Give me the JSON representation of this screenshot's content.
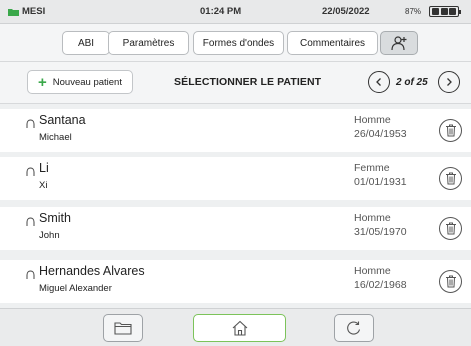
{
  "status_bar": {
    "app_name": "MESI",
    "time": "01:24 PM",
    "date": "22/05/2022",
    "battery_percent": "87%"
  },
  "tabs": [
    {
      "label": "ABI"
    },
    {
      "label": "Paramètres"
    },
    {
      "label": "Formes d'ondes"
    },
    {
      "label": "Commentaires"
    },
    {
      "label": "",
      "icon": "patient-icon",
      "active": true
    }
  ],
  "header": {
    "new_patient_label": "Nouveau patient",
    "title": "SÉLECTIONNER LE PATIENT",
    "pager": "2 of 25"
  },
  "patients": [
    {
      "last_name": "Santana",
      "first_name": "Michael",
      "gender": "Homme",
      "dob": "26/04/1953"
    },
    {
      "last_name": "Li",
      "first_name": "Xi",
      "gender": "Femme",
      "dob": "01/01/1931"
    },
    {
      "last_name": "Smith",
      "first_name": "John",
      "gender": "Homme",
      "dob": "31/05/1970"
    },
    {
      "last_name": "Hernandes Alvares",
      "first_name": "Miguel Alexander",
      "gender": "Homme",
      "dob": "16/02/1968"
    }
  ],
  "bottom_bar": {
    "buttons": [
      {
        "icon": "folder-icon"
      },
      {
        "icon": "home-icon",
        "active": true
      },
      {
        "icon": "refresh-icon"
      }
    ]
  },
  "colors": {
    "accent_green": "#3aa84a",
    "home_border": "#7cc35a",
    "folder_green": "#3aa84a"
  }
}
